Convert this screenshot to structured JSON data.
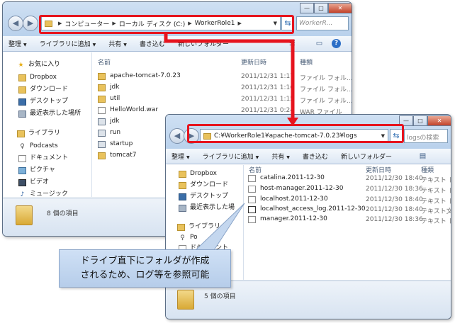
{
  "window1": {
    "address_parts": [
      "コンピューター",
      "ローカル ディスク (C:)",
      "WorkerRole1"
    ],
    "search_placeholder": "WorkerR...",
    "toolbar": {
      "organize": "整理",
      "add_to_library": "ライブラリに追加",
      "share": "共有",
      "burn": "書き込む",
      "new_folder": "新しいフォルダー"
    },
    "columns": {
      "name": "名前",
      "date": "更新日時",
      "type": "種類"
    },
    "sidebar": [
      {
        "label": "お気に入り",
        "icon": "star-icon"
      },
      {
        "label": "Dropbox",
        "icon": "folder-icon"
      },
      {
        "label": "ダウンロード",
        "icon": "download-icon"
      },
      {
        "label": "デスクトップ",
        "icon": "desktop-icon"
      },
      {
        "label": "最近表示した場所",
        "icon": "recent-icon"
      },
      {
        "label": "ライブラリ",
        "icon": "library-icon"
      },
      {
        "label": "Podcasts",
        "icon": "podcast-icon"
      },
      {
        "label": "ドキュメント",
        "icon": "document-icon"
      },
      {
        "label": "ピクチャ",
        "icon": "picture-icon"
      },
      {
        "label": "ビデオ",
        "icon": "video-icon"
      },
      {
        "label": "ミュージック",
        "icon": "music-icon"
      }
    ],
    "files": [
      {
        "name": "apache-tomcat-7.0.23",
        "date": "2011/12/31 1:17",
        "type": "ファイル フォル...",
        "kind": "folder"
      },
      {
        "name": "jdk",
        "date": "2011/12/31 1:16",
        "type": "ファイル フォル...",
        "kind": "folder"
      },
      {
        "name": "util",
        "date": "2011/12/31 1:15",
        "type": "ファイル フォル...",
        "kind": "folder"
      },
      {
        "name": "HelloWorld.war",
        "date": "2011/12/31 0:24",
        "type": "WAR ファイル",
        "kind": "doc"
      },
      {
        "name": "jdk",
        "date": "",
        "type": "",
        "kind": "bat"
      },
      {
        "name": "run",
        "date": "",
        "type": "",
        "kind": "bat"
      },
      {
        "name": "startup",
        "date": "",
        "type": "",
        "kind": "bat"
      },
      {
        "name": "tomcat7",
        "date": "",
        "type": "",
        "kind": "folder"
      }
    ],
    "status": "8 個の項目"
  },
  "window2": {
    "address": "C:¥WorkerRole1¥apache-tomcat-7.0.23¥logs",
    "search_placeholder": "logsの検索",
    "toolbar": {
      "organize": "整理",
      "add_to_library": "ライブラリに追加",
      "share": "共有",
      "burn": "書き込む",
      "new_folder": "新しいフォルダー"
    },
    "columns": {
      "name": "名前",
      "date": "更新日時",
      "type": "種類"
    },
    "sidebar": [
      {
        "label": "Dropbox",
        "icon": "folder-icon"
      },
      {
        "label": "ダウンロード",
        "icon": "download-icon"
      },
      {
        "label": "デスクトップ",
        "icon": "desktop-icon"
      },
      {
        "label": "最近表示した場",
        "icon": "recent-icon"
      },
      {
        "label": "ライブラリ",
        "icon": "library-icon"
      },
      {
        "label": "Po",
        "icon": "podcast-icon"
      },
      {
        "label": "ドキュメント",
        "icon": "document-icon"
      }
    ],
    "files": [
      {
        "name": "catalina.2011-12-30",
        "date": "2011/12/30 18:40",
        "type": "テキスト ド"
      },
      {
        "name": "host-manager.2011-12-30",
        "date": "2011/12/30 18:36",
        "type": "テキスト ド"
      },
      {
        "name": "localhost.2011-12-30",
        "date": "2011/12/30 18:40",
        "type": "テキスト ド"
      },
      {
        "name": "localhost_access_log.2011-12-30",
        "date": "2011/12/30 18:40",
        "type": "テキスト文"
      },
      {
        "name": "manager.2011-12-30",
        "date": "2011/12/30 18:36",
        "type": "テキスト ド"
      }
    ],
    "status": "5 個の項目"
  },
  "callout": {
    "line1": "ドライブ直下にフォルダが作成",
    "line2": "されるため、ログ等を参照可能"
  },
  "colors": {
    "highlight": "#e6141e",
    "callout_bg": "#c4d7ef"
  }
}
